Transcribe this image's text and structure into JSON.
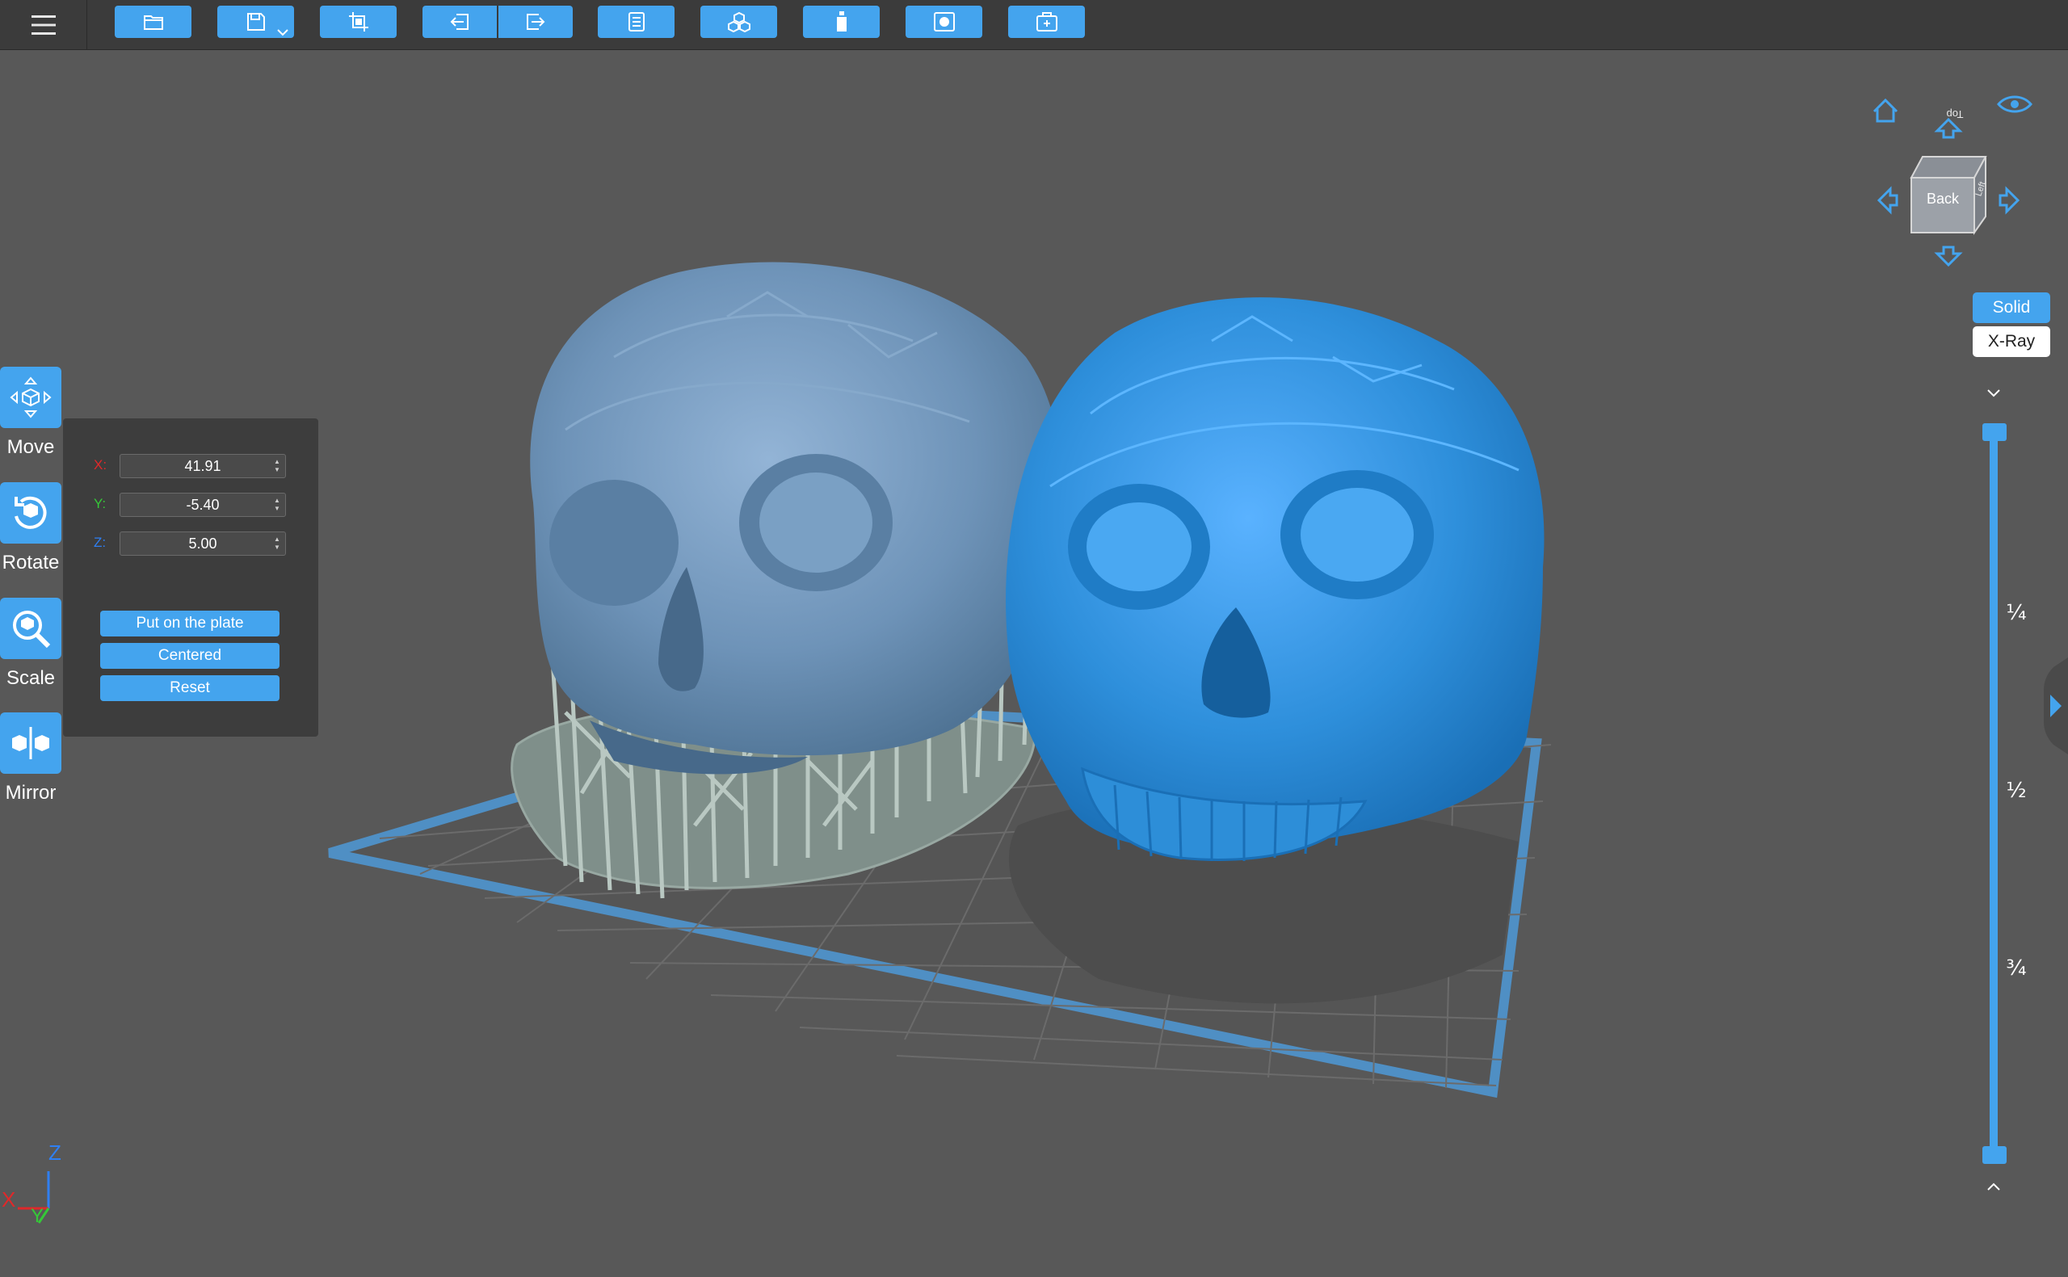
{
  "toolbar": {
    "buttons": [
      "open-file",
      "save",
      "crop-model",
      "undo",
      "redo",
      "slice",
      "supports",
      "hollow",
      "preview",
      "export"
    ]
  },
  "tools": [
    {
      "name": "move",
      "label": "Move"
    },
    {
      "name": "rotate",
      "label": "Rotate"
    },
    {
      "name": "scale",
      "label": "Scale"
    },
    {
      "name": "mirror",
      "label": "Mirror"
    }
  ],
  "move_panel": {
    "x_label": "X:",
    "y_label": "Y:",
    "z_label": "Z:",
    "x_value": "41.91",
    "y_value": "-5.40",
    "z_value": "5.00",
    "put_on_plate": "Put on the plate",
    "centered": "Centered",
    "reset": "Reset"
  },
  "view_cube": {
    "front_face": "Back",
    "top_face": "Top",
    "side_face": "Left"
  },
  "view_modes": {
    "solid": "Solid",
    "xray": "X-Ray",
    "active": "Solid"
  },
  "layer_slider": {
    "marks": [
      "¼",
      "½",
      "¾"
    ],
    "range": [
      0,
      1
    ]
  },
  "axes": {
    "x": "X",
    "y": "Y",
    "z": "Z"
  },
  "colors": {
    "accent": "#44a4ee",
    "background": "#585858",
    "toolbar": "#3b3b3b",
    "panel": "#3d3d3d",
    "axis_x": "#e0282a",
    "axis_y": "#35c838",
    "axis_z": "#2f7ff2",
    "model_selected": "#2e8fdb",
    "model_unselected": "#6e93b8",
    "supports": "#b9c8c2"
  }
}
